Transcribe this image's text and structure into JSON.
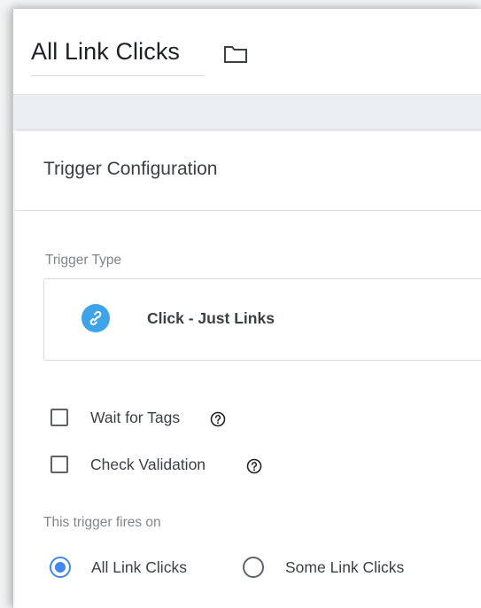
{
  "header": {
    "title": "All Link Clicks",
    "folder_icon": "folder-icon"
  },
  "card": {
    "title": "Trigger Configuration",
    "trigger_type_label": "Trigger Type",
    "trigger_type": {
      "icon": "link-icon",
      "name": "Click - Just Links",
      "badge_color": "#3ea4ea"
    },
    "options": {
      "wait_for_tags": {
        "label": "Wait for Tags",
        "checked": false
      },
      "check_validation": {
        "label": "Check Validation",
        "checked": false
      }
    },
    "fires_on_label": "This trigger fires on",
    "fires_on": {
      "selected": "All Link Clicks",
      "choices": [
        "All Link Clicks",
        "Some Link Clicks"
      ]
    }
  },
  "colors": {
    "accent": "#4285f4",
    "text": "#3c4043",
    "muted": "#80868b"
  }
}
